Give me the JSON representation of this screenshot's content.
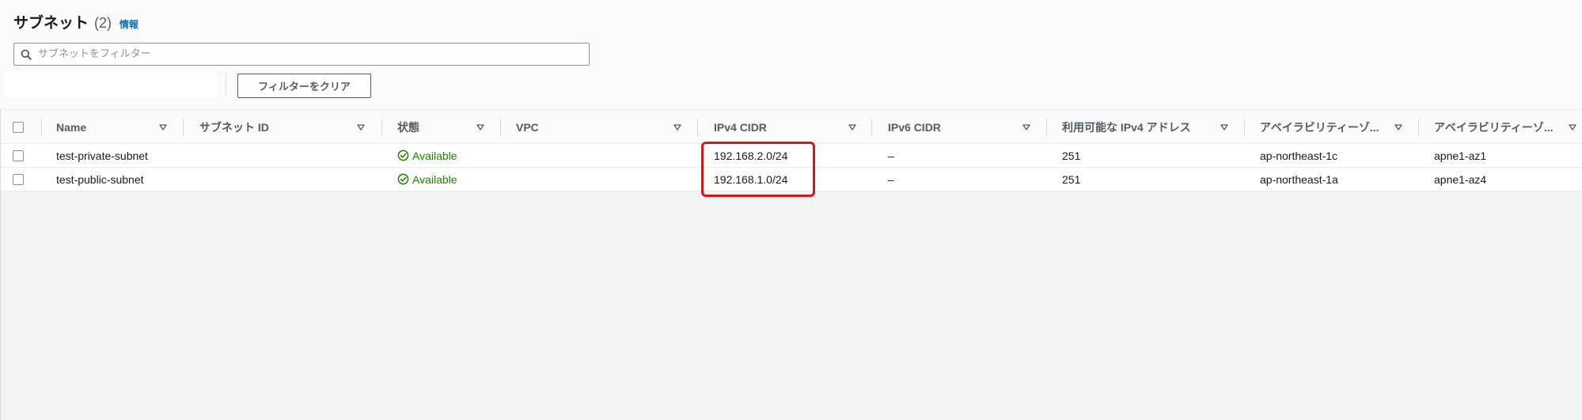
{
  "header": {
    "title": "サブネット",
    "count": "(2)",
    "info_link": "情報"
  },
  "search": {
    "placeholder": "サブネットをフィルター",
    "value": ""
  },
  "clear_filter_label": "フィルターをクリア",
  "table": {
    "columns": [
      "Name",
      "サブネット ID",
      "状態",
      "VPC",
      "IPv4 CIDR",
      "IPv6 CIDR",
      "利用可能な IPv4 アドレス",
      "アベイラビリティーゾ...",
      "アベイラビリティーゾ..."
    ],
    "rows": [
      {
        "name": "test-private-subnet",
        "subnet_id": "",
        "status": "Available",
        "vpc": "",
        "ipv4_cidr": "192.168.2.0/24",
        "ipv6_cidr": "–",
        "available_ipv4": "251",
        "az": "ap-northeast-1c",
        "az_id": "apne1-az1"
      },
      {
        "name": "test-public-subnet",
        "subnet_id": "",
        "status": "Available",
        "vpc": "",
        "ipv4_cidr": "192.168.1.0/24",
        "ipv6_cidr": "–",
        "available_ipv4": "251",
        "az": "ap-northeast-1a",
        "az_id": "apne1-az4"
      }
    ]
  },
  "colors": {
    "status_available": "#1d8102",
    "link": "#0073bb",
    "highlight": "#d0181c"
  }
}
